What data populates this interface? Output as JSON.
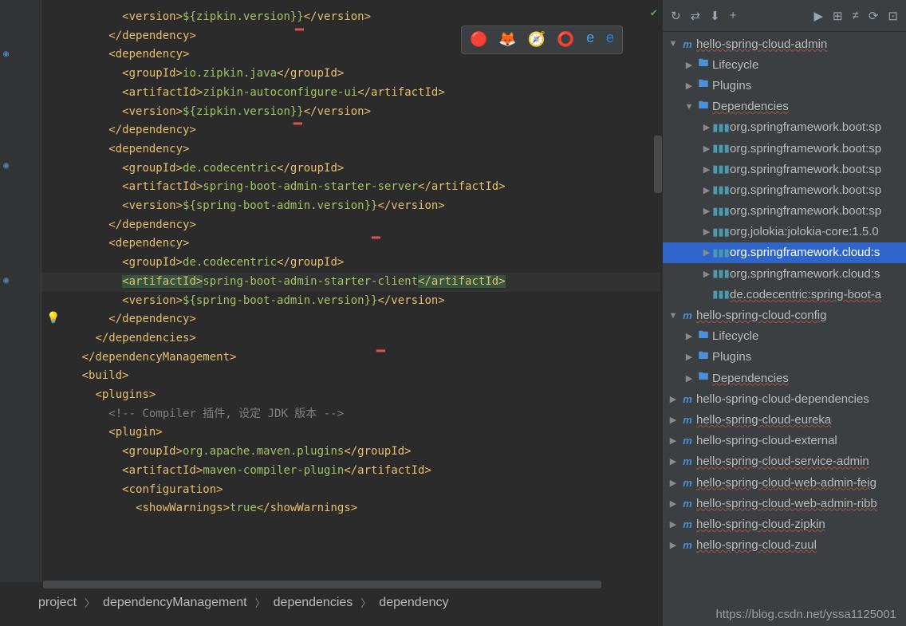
{
  "breadcrumb": [
    "project",
    "dependencyManagement",
    "dependencies",
    "dependency"
  ],
  "watermark": "https://blog.csdn.net/yssa1125001",
  "code_lines": [
    {
      "indent": 12,
      "segs": [
        {
          "c": "t",
          "t": "<version>"
        },
        {
          "c": "g",
          "t": "${zipkin.version}}"
        },
        {
          "c": "t",
          "t": "</version>"
        }
      ]
    },
    {
      "indent": 10,
      "segs": [
        {
          "c": "t",
          "t": "</dependency>"
        }
      ]
    },
    {
      "indent": 10,
      "segs": [
        {
          "c": "t",
          "t": "<dependency>"
        }
      ]
    },
    {
      "indent": 12,
      "segs": [
        {
          "c": "t",
          "t": "<groupId>"
        },
        {
          "c": "g",
          "t": "io.zipkin.java"
        },
        {
          "c": "t",
          "t": "</groupId>"
        }
      ]
    },
    {
      "indent": 12,
      "segs": [
        {
          "c": "t",
          "t": "<artifactId>"
        },
        {
          "c": "g",
          "t": "zipkin-autoconfigure-ui"
        },
        {
          "c": "t",
          "t": "</artifactId>"
        }
      ]
    },
    {
      "indent": 12,
      "segs": [
        {
          "c": "t",
          "t": "<version>"
        },
        {
          "c": "g",
          "t": "${zipkin.version}}"
        },
        {
          "c": "t",
          "t": "</version>"
        }
      ]
    },
    {
      "indent": 10,
      "segs": [
        {
          "c": "t",
          "t": "</dependency>"
        }
      ]
    },
    {
      "indent": 0,
      "segs": []
    },
    {
      "indent": 10,
      "segs": [
        {
          "c": "t",
          "t": "<dependency>"
        }
      ]
    },
    {
      "indent": 12,
      "segs": [
        {
          "c": "t",
          "t": "<groupId>"
        },
        {
          "c": "g",
          "t": "de.codecentric"
        },
        {
          "c": "t",
          "t": "</groupId>"
        }
      ]
    },
    {
      "indent": 12,
      "segs": [
        {
          "c": "t",
          "t": "<artifactId>"
        },
        {
          "c": "g",
          "t": "spring-boot-admin-starter-server"
        },
        {
          "c": "t",
          "t": "</artifactId>"
        }
      ]
    },
    {
      "indent": 12,
      "segs": [
        {
          "c": "t",
          "t": "<version>"
        },
        {
          "c": "g",
          "t": "${spring-boot-admin.version}}"
        },
        {
          "c": "t",
          "t": "</version>"
        }
      ]
    },
    {
      "indent": 10,
      "segs": [
        {
          "c": "t",
          "t": "</dependency>"
        }
      ]
    },
    {
      "indent": 0,
      "segs": []
    },
    {
      "indent": 10,
      "segs": [
        {
          "c": "t",
          "t": "<dependency>"
        }
      ]
    },
    {
      "indent": 12,
      "segs": [
        {
          "c": "t",
          "t": "<groupId>"
        },
        {
          "c": "g",
          "t": "de.codecentric"
        },
        {
          "c": "t",
          "t": "</groupId>"
        }
      ]
    },
    {
      "indent": 12,
      "hl": true,
      "segs": [
        {
          "c": "t",
          "t": "<artifactId>",
          "sel": true
        },
        {
          "c": "g",
          "t": "spring-boot-admin-starter-client"
        },
        {
          "c": "t",
          "t": "</artifactId>",
          "sel": true
        }
      ]
    },
    {
      "indent": 12,
      "segs": [
        {
          "c": "t",
          "t": "<version>"
        },
        {
          "c": "g",
          "t": "${spring-boot-admin.version}}"
        },
        {
          "c": "t",
          "t": "</version>"
        }
      ]
    },
    {
      "indent": 10,
      "segs": [
        {
          "c": "t",
          "t": "</dependency>"
        }
      ]
    },
    {
      "indent": 8,
      "segs": [
        {
          "c": "t",
          "t": "</dependencies>"
        }
      ]
    },
    {
      "indent": 6,
      "segs": [
        {
          "c": "t",
          "t": "</dependencyManagement>"
        }
      ]
    },
    {
      "indent": 0,
      "segs": []
    },
    {
      "indent": 6,
      "segs": [
        {
          "c": "t",
          "t": "<build>"
        }
      ]
    },
    {
      "indent": 8,
      "segs": [
        {
          "c": "t",
          "t": "<plugins>"
        }
      ]
    },
    {
      "indent": 10,
      "segs": [
        {
          "c": "c",
          "t": "<!-- Compiler 插件, 设定 JDK 版本 -->"
        }
      ]
    },
    {
      "indent": 10,
      "segs": [
        {
          "c": "t",
          "t": "<plugin>"
        }
      ]
    },
    {
      "indent": 12,
      "segs": [
        {
          "c": "t",
          "t": "<groupId>"
        },
        {
          "c": "g",
          "t": "org.apache.maven.plugins"
        },
        {
          "c": "t",
          "t": "</groupId>"
        }
      ]
    },
    {
      "indent": 12,
      "segs": [
        {
          "c": "t",
          "t": "<artifactId>"
        },
        {
          "c": "g",
          "t": "maven-compiler-plugin"
        },
        {
          "c": "t",
          "t": "</artifactId>"
        }
      ]
    },
    {
      "indent": 12,
      "segs": [
        {
          "c": "t",
          "t": "<configuration>"
        }
      ]
    },
    {
      "indent": 14,
      "segs": [
        {
          "c": "t",
          "t": "<showWarnings>"
        },
        {
          "c": "g",
          "t": "true"
        },
        {
          "c": "t",
          "t": "</showWarnings>"
        }
      ]
    }
  ],
  "tree": [
    {
      "depth": 0,
      "arrow": "▼",
      "icon": "m",
      "label": "hello-spring-cloud-admin",
      "wavy": true
    },
    {
      "depth": 1,
      "arrow": "▶",
      "icon": "fold",
      "label": "Lifecycle"
    },
    {
      "depth": 1,
      "arrow": "▶",
      "icon": "fold",
      "label": "Plugins"
    },
    {
      "depth": 1,
      "arrow": "▼",
      "icon": "fold",
      "label": "Dependencies",
      "wavy": true
    },
    {
      "depth": 2,
      "arrow": "▶",
      "icon": "lib",
      "label": "org.springframework.boot:sp"
    },
    {
      "depth": 2,
      "arrow": "▶",
      "icon": "lib",
      "label": "org.springframework.boot:sp"
    },
    {
      "depth": 2,
      "arrow": "▶",
      "icon": "lib",
      "label": "org.springframework.boot:sp"
    },
    {
      "depth": 2,
      "arrow": "▶",
      "icon": "lib",
      "label": "org.springframework.boot:sp"
    },
    {
      "depth": 2,
      "arrow": "▶",
      "icon": "lib",
      "label": "org.springframework.boot:sp"
    },
    {
      "depth": 2,
      "arrow": "▶",
      "icon": "lib",
      "label": "org.jolokia:jolokia-core:1.5.0"
    },
    {
      "depth": 2,
      "arrow": "▶",
      "icon": "lib",
      "label": "org.springframework.cloud:s",
      "selected": true
    },
    {
      "depth": 2,
      "arrow": "▶",
      "icon": "lib",
      "label": "org.springframework.cloud:s"
    },
    {
      "depth": 2,
      "arrow": "",
      "icon": "lib",
      "label": "de.codecentric:spring-boot-a",
      "wavy": true
    },
    {
      "depth": 0,
      "arrow": "▼",
      "icon": "m",
      "label": "hello-spring-cloud-config",
      "wavy": true
    },
    {
      "depth": 1,
      "arrow": "▶",
      "icon": "fold",
      "label": "Lifecycle"
    },
    {
      "depth": 1,
      "arrow": "▶",
      "icon": "fold",
      "label": "Plugins"
    },
    {
      "depth": 1,
      "arrow": "▶",
      "icon": "fold",
      "label": "Dependencies",
      "wavy": true
    },
    {
      "depth": 0,
      "arrow": "▶",
      "icon": "m",
      "label": "hello-spring-cloud-dependencies"
    },
    {
      "depth": 0,
      "arrow": "▶",
      "icon": "m",
      "label": "hello-spring-cloud-eureka",
      "wavy": true
    },
    {
      "depth": 0,
      "arrow": "▶",
      "icon": "m",
      "label": "hello-spring-cloud-external"
    },
    {
      "depth": 0,
      "arrow": "▶",
      "icon": "m",
      "label": "hello-spring-cloud-service-admin",
      "wavy": true
    },
    {
      "depth": 0,
      "arrow": "▶",
      "icon": "m",
      "label": "hello-spring-cloud-web-admin-feig",
      "wavy": true
    },
    {
      "depth": 0,
      "arrow": "▶",
      "icon": "m",
      "label": "hello-spring-cloud-web-admin-ribb",
      "wavy": true
    },
    {
      "depth": 0,
      "arrow": "▶",
      "icon": "m",
      "label": "hello-spring-cloud-zipkin",
      "wavy": true
    },
    {
      "depth": 0,
      "arrow": "▶",
      "icon": "m",
      "label": "hello-spring-cloud-zuul",
      "wavy": true
    }
  ],
  "toolbar_icons": [
    "↻",
    "⇄",
    "⬇",
    "+",
    "▶",
    "⊞",
    "≠",
    "⟳",
    "⊡"
  ]
}
